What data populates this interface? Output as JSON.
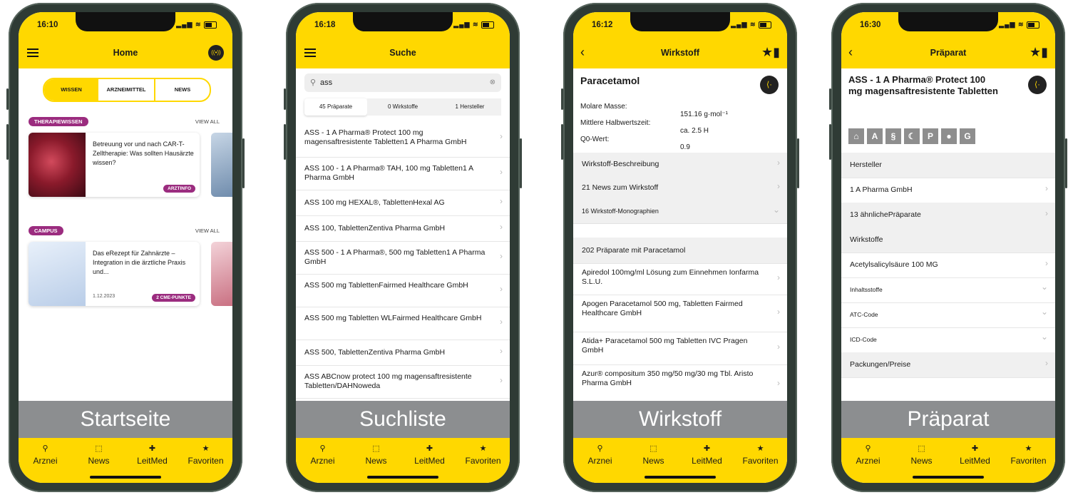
{
  "tabs": {
    "arznei": "Arznei",
    "news": "News",
    "leitmed": "LeitMed",
    "favoriten": "Favoriten"
  },
  "phones": {
    "home": {
      "time": "16:10",
      "title": "Home",
      "segments": [
        "WISSEN",
        "ARZNEIMITTEL",
        "NEWS"
      ],
      "section1": {
        "label": "THERAPIEWISSEN",
        "view_all": "VIEW ALL",
        "card_text": "Betreuung vor und nach CAR-T-Zelltherapie: Was sollten Hausärzte wissen?",
        "badge": "ARZTINFO"
      },
      "section2": {
        "label": "CAMPUS",
        "view_all": "VIEW ALL",
        "card_text": "Das eRezept für Zahnärzte – Integration in die ärztliche Praxis und...",
        "date": "1.12.2023",
        "badge": "2 CME-PUNKTE"
      },
      "caption": "Startseite"
    },
    "suche": {
      "time": "16:18",
      "title": "Suche",
      "query": "ass",
      "filters": [
        "45 Präparate",
        "0 Wirkstoffe",
        "1 Hersteller"
      ],
      "results": [
        "ASS - 1 A Pharma® Protect 100 mg magensaftresistente Tabletten1 A Pharma GmbH",
        "ASS 100 - 1 A Pharma® TAH, 100 mg Tabletten1 A Pharma GmbH",
        "ASS 100 mg HEXAL®, TablettenHexal AG",
        "ASS 100, TablettenZentiva Pharma GmbH",
        "ASS 500 - 1 A Pharma®, 500 mg Tabletten1 A Pharma GmbH",
        "ASS 500 mg TablettenFairmed Healthcare GmbH",
        "ASS 500 mg Tabletten WLFairmed Healthcare GmbH",
        "ASS 500, TablettenZentiva Pharma GmbH",
        "ASS ABCnow protect 100 mg magensaftresistente Tabletten/DAHNoweda"
      ],
      "caption": "Suchliste"
    },
    "wirkstoff": {
      "time": "16:12",
      "title": "Wirkstoff",
      "name": "Paracetamol",
      "props": [
        {
          "k": "Molare Masse:",
          "v": "151.16 g·mol⁻¹"
        },
        {
          "k": "Mittlere Halbwertszeit:",
          "v": "ca. 2.5 H"
        },
        {
          "k": "Q0-Wert:",
          "v": "0.9"
        }
      ],
      "sections": [
        "Wirkstoff-Beschreibung",
        "21 News zum Wirkstoff",
        "16 Wirkstoff-Monographien"
      ],
      "list_header": "202 Präparate mit Paracetamol",
      "items": [
        "Apiredol 100mg/ml Lösung zum Einnehmen Ionfarma S.L.U.",
        "Apogen Paracetamol 500 mg, Tabletten Fairmed Healthcare GmbH",
        "Atida+ Paracetamol 500 mg Tabletten IVC Pragen GmbH",
        "Azur® compositum 350 mg/50 mg/30 mg Tbl. Aristo Pharma GmbH"
      ],
      "caption": "Wirkstoff"
    },
    "praeparat": {
      "time": "16:30",
      "title": "Präparat",
      "name": "ASS - 1 A Pharma® Protect 100 mg magensaftresistente Tabletten",
      "rows": [
        {
          "t": "Hersteller",
          "type": "header"
        },
        {
          "t": "1 A Pharma GmbH",
          "type": "link"
        },
        {
          "t": "13 ähnlichePräparate",
          "type": "grey-link"
        },
        {
          "t": "Wirkstoffe",
          "type": "header"
        },
        {
          "t": "Acetylsalicylsäure 100 MG",
          "type": "link"
        },
        {
          "t": "Inhaltsstoffe",
          "type": "small"
        },
        {
          "t": "ATC-Code",
          "type": "small"
        },
        {
          "t": "ICD-Code",
          "type": "small"
        },
        {
          "t": "Packungen/Preise",
          "type": "grey-link"
        }
      ],
      "caption": "Präparat"
    }
  }
}
